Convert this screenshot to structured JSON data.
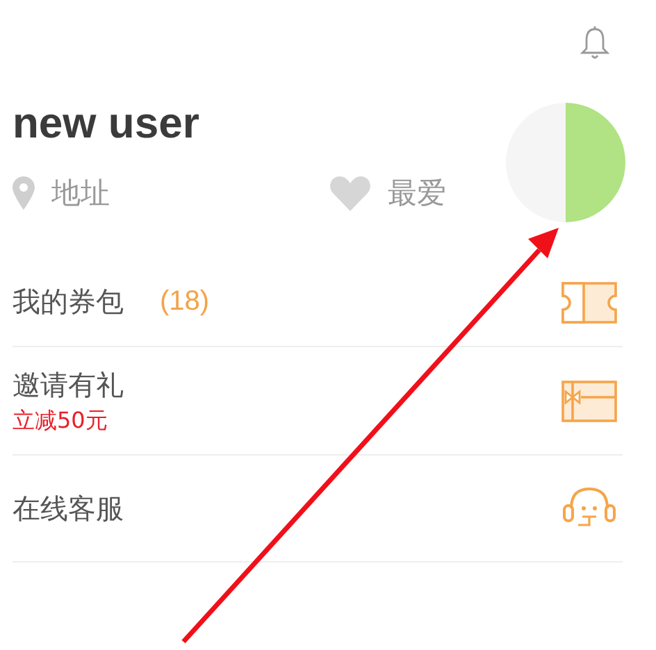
{
  "user": {
    "name": "new user",
    "links": [
      {
        "kind": "address",
        "label": "地址"
      },
      {
        "kind": "favorite",
        "label": "最爱"
      }
    ]
  },
  "menu": [
    {
      "kind": "coupon",
      "label": "我的券包",
      "count": "(18)"
    },
    {
      "kind": "invite",
      "label": "邀请有礼",
      "note": "立减50元"
    },
    {
      "kind": "service",
      "label": "在线客服"
    }
  ]
}
